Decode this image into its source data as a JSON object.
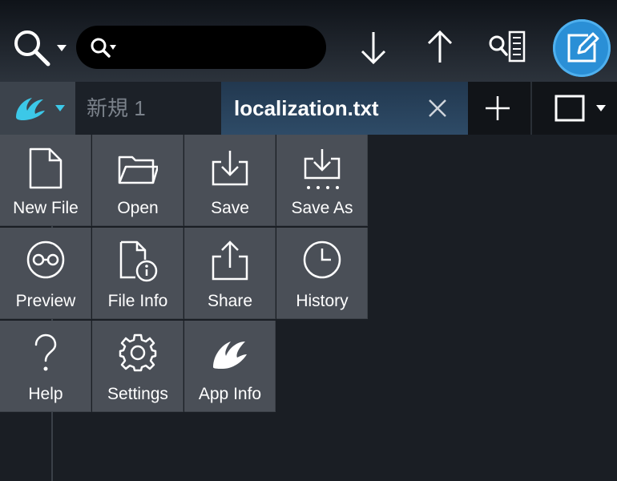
{
  "toolbar": {
    "search_placeholder": "",
    "edit_button_color": "#2a8fd6"
  },
  "tabs": [
    {
      "label": "新規 1",
      "active": false
    },
    {
      "label": "localization.txt",
      "active": true
    }
  ],
  "menu": {
    "items": [
      {
        "label": "New File",
        "icon": "new-file-icon"
      },
      {
        "label": "Open",
        "icon": "folder-icon"
      },
      {
        "label": "Save",
        "icon": "save-icon"
      },
      {
        "label": "Save As",
        "icon": "save-as-icon"
      },
      {
        "label": "Preview",
        "icon": "preview-icon"
      },
      {
        "label": "File Info",
        "icon": "file-info-icon"
      },
      {
        "label": "Share",
        "icon": "share-icon"
      },
      {
        "label": "History",
        "icon": "clock-icon"
      },
      {
        "label": "Help",
        "icon": "question-icon"
      },
      {
        "label": "Settings",
        "icon": "gear-icon"
      },
      {
        "label": "App Info",
        "icon": "app-logo-icon"
      }
    ]
  },
  "colors": {
    "accent_blue": "#2a8fd6",
    "logo_cyan": "#3cc8e8",
    "menu_bg": "#4a4f57",
    "background": "#1a1e24"
  }
}
